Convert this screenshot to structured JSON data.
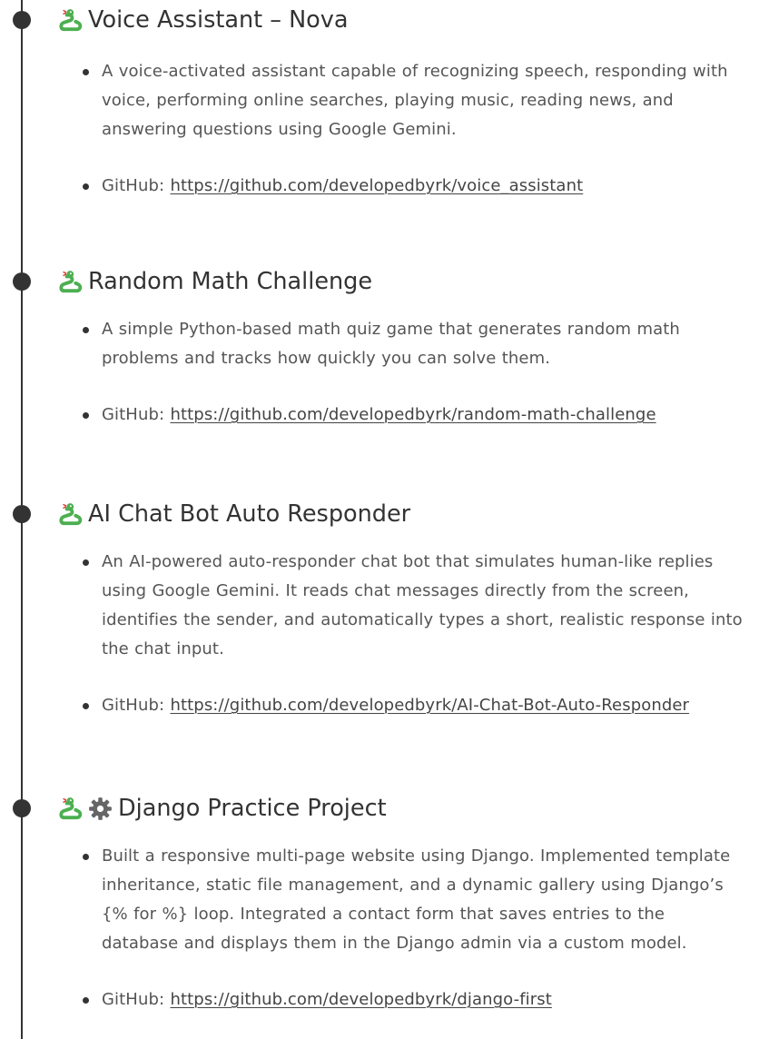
{
  "colors": {
    "text": "#333333",
    "body_text": "#555555",
    "timeline": "#333333",
    "icon_green": "#4caf50",
    "icon_red": "#e53935",
    "gear": "#666666"
  },
  "projects": [
    {
      "icon": "snake-icon",
      "title": "Voice Assistant – Nova",
      "description": "A voice-activated assistant capable of recognizing speech, responding with voice, performing online searches, playing music, reading news, and answering questions using Google Gemini.",
      "github_label": "GitHub: ",
      "github_url": "https://github.com/developedbyrk/voice_assistant"
    },
    {
      "icon": "snake-icon",
      "title": "Random Math Challenge",
      "description": "A simple Python-based math quiz game that generates random math problems and tracks how quickly you can solve them.",
      "github_label": "GitHub: ",
      "github_url": "https://github.com/developedbyrk/random-math-challenge"
    },
    {
      "icon": "snake-icon",
      "title": "AI Chat Bot Auto Responder",
      "description": "An AI-powered auto-responder chat bot that simulates human-like replies using Google Gemini. It reads chat messages directly from the screen, identifies the sender, and automatically types a short, realistic response into the chat input.",
      "github_label": "GitHub: ",
      "github_url": "https://github.com/developedbyrk/AI-Chat-Bot-Auto-Responder"
    },
    {
      "icon": "snake-icon",
      "extra_icon": "gear-icon",
      "title": "Django Practice Project",
      "description": "Built a responsive multi-page website using Django. Implemented template inheritance, static file management, and a dynamic gallery using Django’s {% for %} loop. Integrated a contact form that saves entries to the database and displays them in the Django admin via a custom model.",
      "github_label": "GitHub: ",
      "github_url": "https://github.com/developedbyrk/django-first"
    }
  ]
}
